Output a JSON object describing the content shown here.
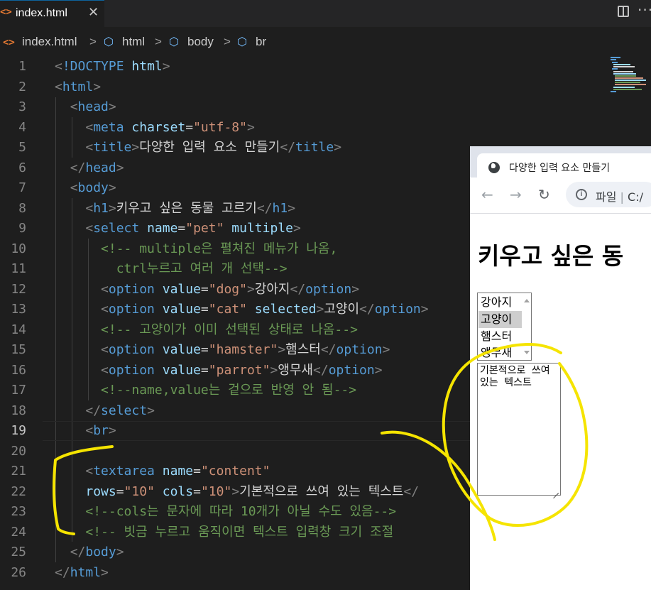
{
  "tab": {
    "icon": "<>",
    "label": "index.html",
    "close": "✕"
  },
  "breadcrumb": {
    "file_icon": "<>",
    "file": "index.html",
    "items": [
      "html",
      "body",
      "br"
    ],
    "separator": ">"
  },
  "editor": {
    "active_line": 19,
    "lines": [
      {
        "n": "1",
        "tokens": [
          [
            "t",
            "<"
          ],
          [
            "kw",
            "!DOCTYPE "
          ],
          [
            "attr",
            "html"
          ],
          [
            "t",
            ">"
          ]
        ]
      },
      {
        "n": "2",
        "tokens": [
          [
            "t",
            "<"
          ],
          [
            "tag",
            "html"
          ],
          [
            "t",
            ">"
          ]
        ]
      },
      {
        "n": "3",
        "tokens": [
          [
            "txt",
            "  "
          ],
          [
            "t",
            "<"
          ],
          [
            "tag",
            "head"
          ],
          [
            "t",
            ">"
          ]
        ]
      },
      {
        "n": "4",
        "tokens": [
          [
            "txt",
            "    "
          ],
          [
            "t",
            "<"
          ],
          [
            "tag",
            "meta "
          ],
          [
            "attr",
            "charset"
          ],
          [
            "txt",
            "="
          ],
          [
            "val",
            "\"utf-8\""
          ],
          [
            "t",
            ">"
          ]
        ]
      },
      {
        "n": "5",
        "tokens": [
          [
            "txt",
            "    "
          ],
          [
            "t",
            "<"
          ],
          [
            "tag",
            "title"
          ],
          [
            "t",
            ">"
          ],
          [
            "txt",
            "다양한 입력 요소 만들기"
          ],
          [
            "t",
            "</"
          ],
          [
            "tag",
            "title"
          ],
          [
            "t",
            ">"
          ]
        ]
      },
      {
        "n": "6",
        "tokens": [
          [
            "txt",
            "  "
          ],
          [
            "t",
            "</"
          ],
          [
            "tag",
            "head"
          ],
          [
            "t",
            ">"
          ]
        ]
      },
      {
        "n": "7",
        "tokens": [
          [
            "txt",
            "  "
          ],
          [
            "t",
            "<"
          ],
          [
            "tag",
            "body"
          ],
          [
            "t",
            ">"
          ]
        ]
      },
      {
        "n": "8",
        "tokens": [
          [
            "txt",
            "    "
          ],
          [
            "t",
            "<"
          ],
          [
            "tag",
            "h1"
          ],
          [
            "t",
            ">"
          ],
          [
            "txt",
            "키우고 싶은 동물 고르기"
          ],
          [
            "t",
            "</"
          ],
          [
            "tag",
            "h1"
          ],
          [
            "t",
            ">"
          ]
        ]
      },
      {
        "n": "9",
        "tokens": [
          [
            "txt",
            "    "
          ],
          [
            "t",
            "<"
          ],
          [
            "tag",
            "select "
          ],
          [
            "attr",
            "name"
          ],
          [
            "txt",
            "="
          ],
          [
            "val",
            "\"pet\" "
          ],
          [
            "attr",
            "multiple"
          ],
          [
            "t",
            ">"
          ]
        ]
      },
      {
        "n": "10",
        "tokens": [
          [
            "txt",
            "      "
          ],
          [
            "cm",
            "<!-- multiple은 펼쳐진 메뉴가 나옴,"
          ]
        ]
      },
      {
        "n": "11",
        "tokens": [
          [
            "txt",
            "        "
          ],
          [
            "cm",
            "ctrl누르고 여러 개 선택-->"
          ]
        ]
      },
      {
        "n": "12",
        "tokens": [
          [
            "txt",
            "      "
          ],
          [
            "t",
            "<"
          ],
          [
            "tag",
            "option "
          ],
          [
            "attr",
            "value"
          ],
          [
            "txt",
            "="
          ],
          [
            "val",
            "\"dog\""
          ],
          [
            "t",
            ">"
          ],
          [
            "txt",
            "강아지"
          ],
          [
            "t",
            "</"
          ],
          [
            "tag",
            "option"
          ],
          [
            "t",
            ">"
          ]
        ]
      },
      {
        "n": "13",
        "tokens": [
          [
            "txt",
            "      "
          ],
          [
            "t",
            "<"
          ],
          [
            "tag",
            "option "
          ],
          [
            "attr",
            "value"
          ],
          [
            "txt",
            "="
          ],
          [
            "val",
            "\"cat\" "
          ],
          [
            "attr",
            "selected"
          ],
          [
            "t",
            ">"
          ],
          [
            "txt",
            "고양이"
          ],
          [
            "t",
            "</"
          ],
          [
            "tag",
            "option"
          ],
          [
            "t",
            ">"
          ]
        ]
      },
      {
        "n": "14",
        "tokens": [
          [
            "txt",
            "      "
          ],
          [
            "cm",
            "<!-- 고양이가 이미 선택된 상태로 나옴-->"
          ]
        ]
      },
      {
        "n": "15",
        "tokens": [
          [
            "txt",
            "      "
          ],
          [
            "t",
            "<"
          ],
          [
            "tag",
            "option "
          ],
          [
            "attr",
            "value"
          ],
          [
            "txt",
            "="
          ],
          [
            "val",
            "\"hamster\""
          ],
          [
            "t",
            ">"
          ],
          [
            "txt",
            "햄스터"
          ],
          [
            "t",
            "</"
          ],
          [
            "tag",
            "option"
          ],
          [
            "t",
            ">"
          ]
        ]
      },
      {
        "n": "16",
        "tokens": [
          [
            "txt",
            "      "
          ],
          [
            "t",
            "<"
          ],
          [
            "tag",
            "option "
          ],
          [
            "attr",
            "value"
          ],
          [
            "txt",
            "="
          ],
          [
            "val",
            "\"parrot\""
          ],
          [
            "t",
            ">"
          ],
          [
            "txt",
            "앵무새"
          ],
          [
            "t",
            "</"
          ],
          [
            "tag",
            "option"
          ],
          [
            "t",
            ">"
          ]
        ]
      },
      {
        "n": "17",
        "tokens": [
          [
            "txt",
            "      "
          ],
          [
            "cm",
            "<!--name,value는 겉으로 반영 안 됨-->"
          ]
        ]
      },
      {
        "n": "18",
        "tokens": [
          [
            "txt",
            "    "
          ],
          [
            "t",
            "</"
          ],
          [
            "tag",
            "select"
          ],
          [
            "t",
            ">"
          ]
        ]
      },
      {
        "n": "19",
        "tokens": [
          [
            "txt",
            "    "
          ],
          [
            "t",
            "<"
          ],
          [
            "tag",
            "br"
          ],
          [
            "t",
            ">"
          ]
        ]
      },
      {
        "n": "20",
        "tokens": []
      },
      {
        "n": "21",
        "tokens": [
          [
            "txt",
            "    "
          ],
          [
            "t",
            "<"
          ],
          [
            "tag",
            "textarea "
          ],
          [
            "attr",
            "name"
          ],
          [
            "txt",
            "="
          ],
          [
            "val",
            "\"content\""
          ]
        ]
      },
      {
        "n": "22",
        "tokens": [
          [
            "txt",
            "    "
          ],
          [
            "attr",
            "rows"
          ],
          [
            "txt",
            "="
          ],
          [
            "val",
            "\"10\" "
          ],
          [
            "attr",
            "cols"
          ],
          [
            "txt",
            "="
          ],
          [
            "val",
            "\"10\""
          ],
          [
            "t",
            ">"
          ],
          [
            "txt",
            "기본적으로 쓰여 있는 텍스트"
          ],
          [
            "t",
            "</"
          ]
        ]
      },
      {
        "n": "23",
        "tokens": [
          [
            "txt",
            "    "
          ],
          [
            "cm",
            "<!--cols는 문자에 따라 10개가 아닐 수도 있음-->"
          ]
        ]
      },
      {
        "n": "24",
        "tokens": [
          [
            "txt",
            "    "
          ],
          [
            "cm",
            "<!-- 빗금 누르고 움직이면 텍스트 입력창 크기 조절"
          ]
        ]
      },
      {
        "n": "25",
        "tokens": [
          [
            "txt",
            "  "
          ],
          [
            "t",
            "</"
          ],
          [
            "tag",
            "body"
          ],
          [
            "t",
            ">"
          ]
        ]
      },
      {
        "n": "26",
        "tokens": [
          [
            "t",
            "</"
          ],
          [
            "tag",
            "html"
          ],
          [
            "t",
            ">"
          ]
        ]
      }
    ]
  },
  "browser": {
    "tab_title": "다양한 입력 요소 만들기",
    "address_prefix": "파일",
    "address_sep": "|",
    "address": "C:/",
    "page": {
      "h1": "키우고 싶은 동",
      "select_options": [
        "강아지",
        "고양이",
        "햄스터",
        "앵무새"
      ],
      "selected_option": "고양이",
      "textarea_value": "기본적으로 쓰여 있는 텍스트"
    }
  },
  "annotation_color": "#f5e400",
  "colors": {
    "tag": "#569cd6",
    "attr": "#9cdcfe",
    "value": "#ce9178",
    "comment": "#6a9955",
    "punct": "#808080",
    "editor_bg": "#1e1e1e"
  }
}
